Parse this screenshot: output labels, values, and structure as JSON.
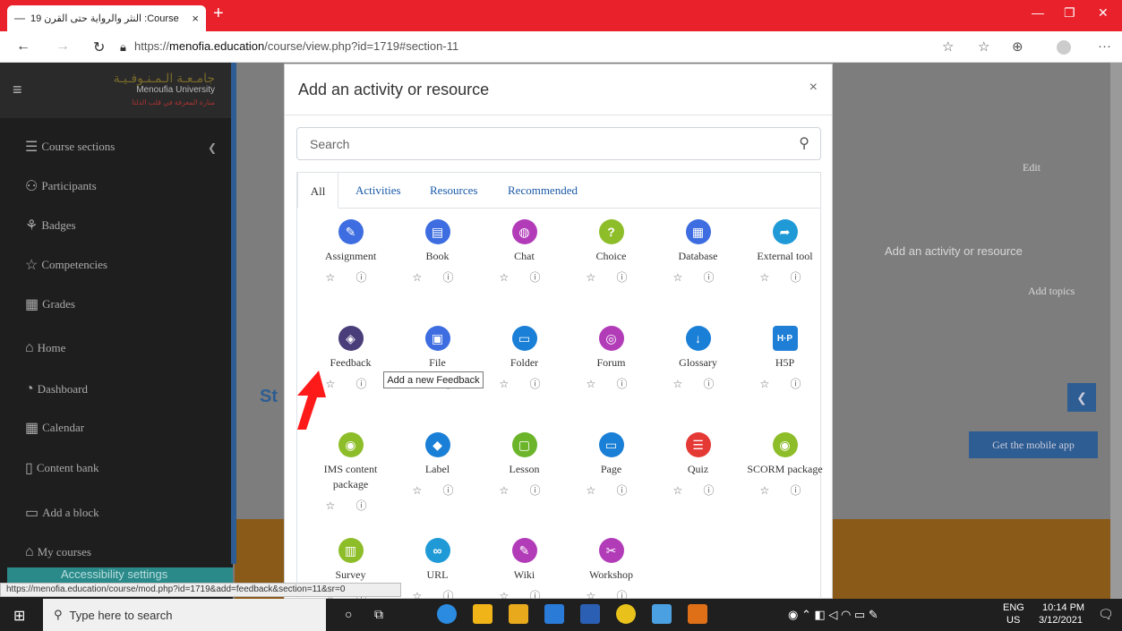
{
  "browser": {
    "tab_title": "النثر والرواية حتى القرن 19 :Course",
    "tab_close": "×",
    "new_tab": "+",
    "url_prefix": "https://",
    "url_domain": "menofia.education",
    "url_path": "/course/view.php?id=1719#section-11",
    "status_url": "https://menofia.education/course/mod.php?id=1719&add=feedback&section=11&sr=0"
  },
  "sidebar": {
    "logo_line1": "جامـعـة الـمـنـوفـيـة",
    "logo_line2": "Menoufia University",
    "logo_line3": "منارة المعرفة في قلب الدلتا",
    "items": [
      {
        "label": "Course sections",
        "icon": "list-icon"
      },
      {
        "label": "Participants",
        "icon": "users-icon"
      },
      {
        "label": "Badges",
        "icon": "badge-icon"
      },
      {
        "label": "Competencies",
        "icon": "star-icon"
      },
      {
        "label": "Grades",
        "icon": "table-icon"
      },
      {
        "label": "Home",
        "icon": "home-icon"
      },
      {
        "label": "Dashboard",
        "icon": "gauge-icon"
      },
      {
        "label": "Calendar",
        "icon": "calendar-icon"
      },
      {
        "label": "Content bank",
        "icon": "file-icon"
      },
      {
        "label": "Add a block",
        "icon": "square-icon"
      },
      {
        "label": "My courses",
        "icon": "cap-icon"
      }
    ],
    "accessibility": "Accessibility settings"
  },
  "background": {
    "edit": "Edit",
    "add_activity": "Add an activity or resource",
    "add_topics": "Add topics",
    "mobile_app": "Get the mobile app",
    "st": "St"
  },
  "modal": {
    "title": "Add an activity or resource",
    "close": "×",
    "search_placeholder": "Search",
    "tabs": [
      "All",
      "Activities",
      "Resources",
      "Recommended"
    ],
    "tooltip": "Add a new Feedback",
    "modules": [
      {
        "name": "Assignment",
        "color": "#3d6de0",
        "glyph": "✎"
      },
      {
        "name": "Book",
        "color": "#3d6de0",
        "glyph": "▤"
      },
      {
        "name": "Chat",
        "color": "#b23cb8",
        "glyph": "◍"
      },
      {
        "name": "Choice",
        "color": "#8ebd2a",
        "glyph": "?"
      },
      {
        "name": "Database",
        "color": "#3d6de0",
        "glyph": "▦"
      },
      {
        "name": "External tool",
        "color": "#1f9ad6",
        "glyph": "➦"
      },
      {
        "name": "Feedback",
        "color": "#4a3e7a",
        "glyph": "◈"
      },
      {
        "name": "File",
        "color": "#3d6de0",
        "glyph": "▣"
      },
      {
        "name": "Folder",
        "color": "#1a7fd6",
        "glyph": "▭"
      },
      {
        "name": "Forum",
        "color": "#b23cb8",
        "glyph": "◎"
      },
      {
        "name": "Glossary",
        "color": "#1a7fd6",
        "glyph": "↓"
      },
      {
        "name": "H5P",
        "color": "#1f7fd6",
        "glyph": "H·P"
      },
      {
        "name": "IMS content package",
        "color": "#8ebd2a",
        "glyph": "◉"
      },
      {
        "name": "Label",
        "color": "#1a7fd6",
        "glyph": "◆"
      },
      {
        "name": "Lesson",
        "color": "#6cb52a",
        "glyph": "▢"
      },
      {
        "name": "Page",
        "color": "#1a7fd6",
        "glyph": "▭"
      },
      {
        "name": "Quiz",
        "color": "#e53935",
        "glyph": "☰"
      },
      {
        "name": "SCORM package",
        "color": "#8ebd2a",
        "glyph": "◉"
      },
      {
        "name": "Survey",
        "color": "#8ebd2a",
        "glyph": "▥"
      },
      {
        "name": "URL",
        "color": "#1f9ad6",
        "glyph": "∞"
      },
      {
        "name": "Wiki",
        "color": "#b23cb8",
        "glyph": "✎"
      },
      {
        "name": "Workshop",
        "color": "#b23cb8",
        "glyph": "✂"
      }
    ]
  },
  "taskbar": {
    "search_placeholder": "Type here to search",
    "lang": "ENG",
    "region": "US",
    "time": "10:14 PM",
    "date": "3/12/2021"
  }
}
